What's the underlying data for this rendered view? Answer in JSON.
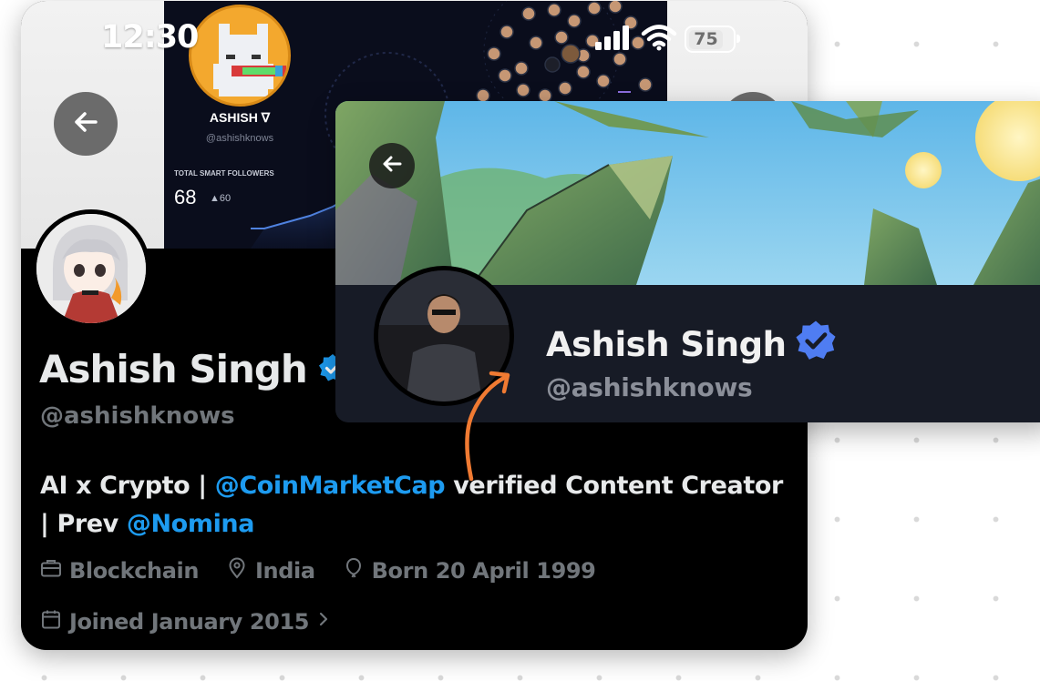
{
  "status_bar": {
    "time": "12:30",
    "battery": "75"
  },
  "embedded_screenshot": {
    "name": "ASHISH ∇",
    "handle": "@ashishknows",
    "stat_label": "TOTAL SMART FOLLOWERS",
    "stat_value": "68",
    "stat_delta": "▲60"
  },
  "profile": {
    "name": "Ashish Singh",
    "handle": "@ashishknows",
    "bio": {
      "part1": "AI x Crypto | ",
      "mention1": "@CoinMarketCap",
      "part2": " verified Content Creator | Prev ",
      "mention2": "@Nomina"
    },
    "category": "Blockchain",
    "location": "India",
    "birthday": "Born 20 April 1999",
    "joined": "Joined January 2015"
  },
  "card": {
    "name": "Ashish Singh",
    "handle": "@ashishknows"
  },
  "colors": {
    "verified": "#1d9bf0",
    "card_verified": "#4f7df2",
    "arrow": "#f07a32",
    "link": "#1d9bf0"
  },
  "icons": [
    "back-arrow-icon",
    "signal-icon",
    "wifi-icon",
    "battery-icon",
    "verified-badge-icon",
    "briefcase-icon",
    "location-pin-icon",
    "balloon-icon",
    "calendar-icon",
    "chevron-right-icon"
  ]
}
